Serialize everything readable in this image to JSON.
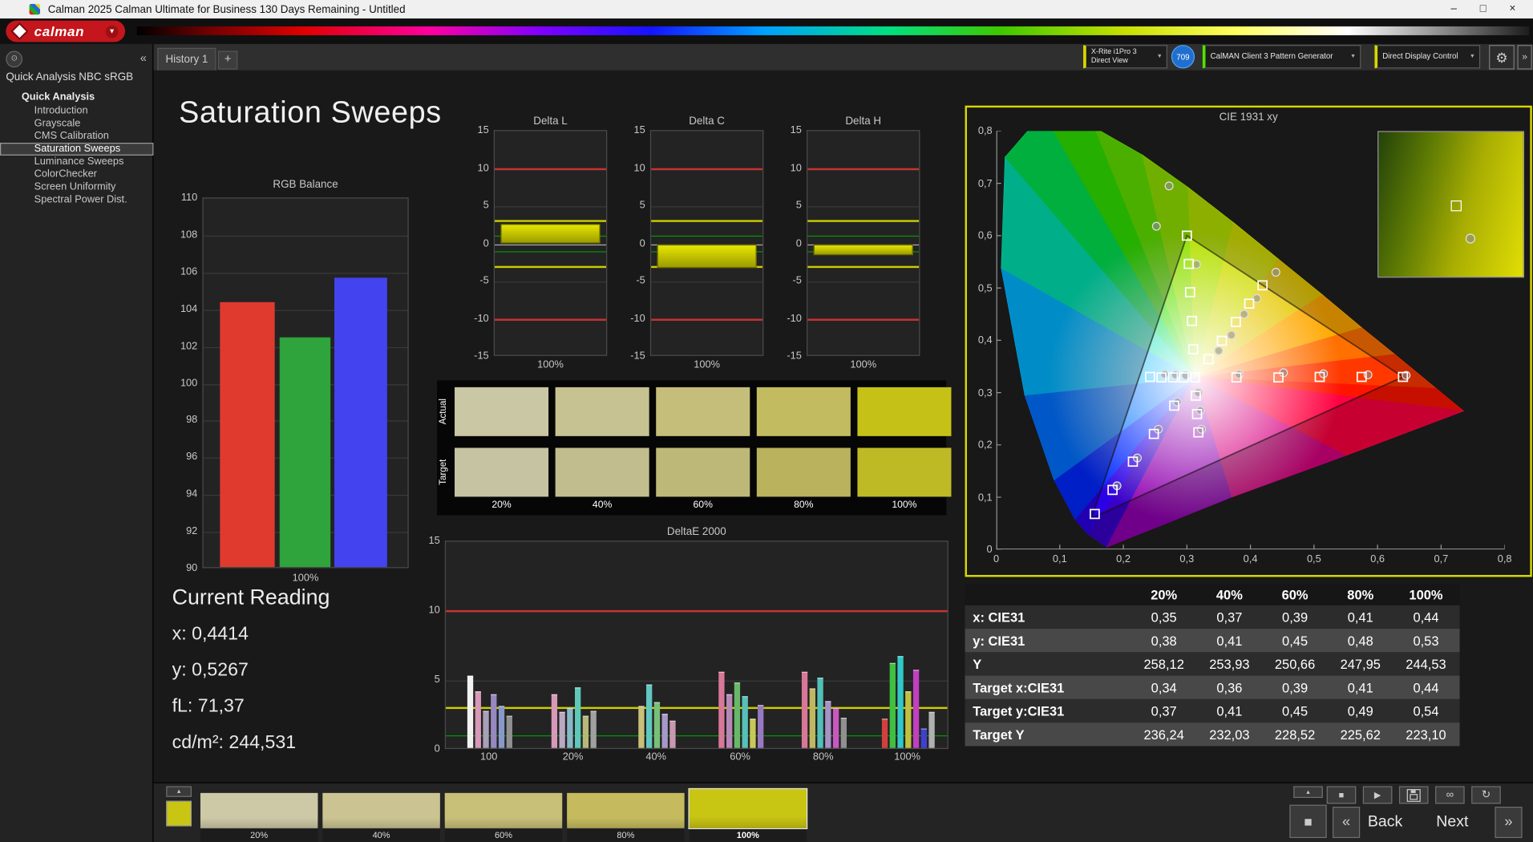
{
  "window": {
    "title": "Calman 2025 Calman Ultimate for Business 130 Days Remaining  - Untitled"
  },
  "icons": {
    "minimize": "–",
    "maximize": "□",
    "close": "×",
    "caret_down": "▼",
    "collapse": "«",
    "expand": "»",
    "add_tab": "+",
    "gear": "⚙",
    "nav_circle": "⊙",
    "stop": "■",
    "play": "▶",
    "infinity": "∞",
    "up_small": "▴",
    "refresh": "↻",
    "back_chevron": "«",
    "next_chevron": "»",
    "square": "■"
  },
  "colors": {
    "meter_accent": "#d8d800",
    "source_accent": "#54e000",
    "display_accent": "#d8d800",
    "badge_blue": "#1f6fd0",
    "ref_red": "#c83232",
    "ref_yellow": "#cccc00",
    "ref_green": "#009900",
    "panel_border_yellow": "#d8d800"
  },
  "brand": {
    "logo_text": "calman"
  },
  "tabs": {
    "history": "History 1",
    "add": "+"
  },
  "toolbar": {
    "meter_line1": "X-Rite i1Pro 3",
    "meter_line2": "Direct View",
    "badge": "709",
    "source": "CalMAN Client 3 Pattern Generator",
    "display": "Direct Display Control"
  },
  "sidebar": {
    "header": "Quick Analysis NBC sRGB",
    "root": "Quick Analysis",
    "items": [
      "Introduction",
      "Grayscale",
      "CMS Calibration",
      "Saturation Sweeps",
      "Luminance Sweeps",
      "ColorChecker",
      "Screen Uniformity",
      "Spectral Power Dist."
    ],
    "selected_index": 3
  },
  "page": {
    "title": "Saturation Sweeps"
  },
  "current_reading": {
    "title": "Current Reading",
    "lines": [
      "x: 0,4414",
      "y: 0,5267",
      "fL: 71,37",
      "cd/m²: 244,531"
    ]
  },
  "swatch_panel": {
    "row_labels": [
      "Actual",
      "Target"
    ],
    "labels": [
      "20%",
      "40%",
      "60%",
      "80%",
      "100%"
    ],
    "actual": [
      "#c9c7a4",
      "#c7c292",
      "#c5be7a",
      "#c3bb60",
      "#c5c117"
    ],
    "target": [
      "#c6c3a2",
      "#c2bd8e",
      "#beb878",
      "#bab25c",
      "#beba26"
    ]
  },
  "table": {
    "headers": [
      "20%",
      "40%",
      "60%",
      "80%",
      "100%"
    ],
    "rows": [
      {
        "label": "x: CIE31",
        "values": [
          "0,35",
          "0,37",
          "0,39",
          "0,41",
          "0,44"
        ]
      },
      {
        "label": "y: CIE31",
        "values": [
          "0,38",
          "0,41",
          "0,45",
          "0,48",
          "0,53"
        ]
      },
      {
        "label": "Y",
        "values": [
          "258,12",
          "253,93",
          "250,66",
          "247,95",
          "244,53"
        ]
      },
      {
        "label": "Target x:CIE31",
        "values": [
          "0,34",
          "0,36",
          "0,39",
          "0,41",
          "0,44"
        ]
      },
      {
        "label": "Target y:CIE31",
        "values": [
          "0,37",
          "0,41",
          "0,45",
          "0,49",
          "0,54"
        ]
      },
      {
        "label": "Target Y",
        "values": [
          "236,24",
          "232,03",
          "228,52",
          "225,62",
          "223,10"
        ]
      }
    ]
  },
  "bottom": {
    "labels": [
      "20%",
      "40%",
      "60%",
      "80%",
      "100%"
    ],
    "colors": [
      "#cdc9a6",
      "#cbc492",
      "#c8bf78",
      "#c5bb5e",
      "#c9c513"
    ],
    "selected_index": 4,
    "back": "Back",
    "next": "Next"
  },
  "chart_data": [
    {
      "id": "rgb_balance",
      "type": "bar",
      "title": "RGB Balance",
      "categories": [
        "Red",
        "Green",
        "Blue"
      ],
      "values": [
        104.3,
        102.4,
        105.6
      ],
      "colors": [
        "#e03a2f",
        "#2fa33c",
        "#4343f0"
      ],
      "ylim": [
        90,
        110
      ],
      "ytick_step": 2,
      "xlabel": "100%"
    },
    {
      "id": "delta_l",
      "type": "bar",
      "title": "Delta L",
      "values": [
        2.6
      ],
      "ylim": [
        -15,
        15
      ],
      "xlabel": "100%",
      "ref_lines": [
        {
          "v": 10,
          "c": "#c83232",
          "w": 2
        },
        {
          "v": -10,
          "c": "#c83232",
          "w": 2
        },
        {
          "v": 3,
          "c": "#cccc00",
          "w": 2
        },
        {
          "v": -3,
          "c": "#cccc00",
          "w": 2
        },
        {
          "v": 1,
          "c": "#009900",
          "w": 1
        },
        {
          "v": -1,
          "c": "#009900",
          "w": 1
        }
      ]
    },
    {
      "id": "delta_c",
      "type": "bar",
      "title": "Delta C",
      "values": [
        -3.2
      ],
      "ylim": [
        -15,
        15
      ],
      "xlabel": "100%",
      "ref_lines": [
        {
          "v": 10,
          "c": "#c83232",
          "w": 2
        },
        {
          "v": -10,
          "c": "#c83232",
          "w": 2
        },
        {
          "v": 3,
          "c": "#cccc00",
          "w": 2
        },
        {
          "v": -3,
          "c": "#cccc00",
          "w": 2
        },
        {
          "v": 1,
          "c": "#009900",
          "w": 1
        },
        {
          "v": -1,
          "c": "#009900",
          "w": 1
        }
      ]
    },
    {
      "id": "delta_h",
      "type": "bar",
      "title": "Delta H",
      "values": [
        -1.5
      ],
      "ylim": [
        -15,
        15
      ],
      "xlabel": "100%",
      "ref_lines": [
        {
          "v": 10,
          "c": "#c83232",
          "w": 2
        },
        {
          "v": -10,
          "c": "#c83232",
          "w": 2
        },
        {
          "v": 3,
          "c": "#cccc00",
          "w": 2
        },
        {
          "v": -3,
          "c": "#cccc00",
          "w": 2
        },
        {
          "v": 1,
          "c": "#009900",
          "w": 1
        },
        {
          "v": -1,
          "c": "#009900",
          "w": 1
        }
      ]
    },
    {
      "id": "deltae2000",
      "type": "bar",
      "title": "DeltaE 2000",
      "ylim": [
        0,
        15
      ],
      "categories": [
        "100",
        "20%",
        "40%",
        "60%",
        "80%",
        "100%"
      ],
      "ref_lines": [
        {
          "v": 10,
          "c": "#c83232",
          "w": 2
        },
        {
          "v": 3,
          "c": "#cccc00",
          "w": 2
        },
        {
          "v": 1,
          "c": "#009900",
          "w": 1
        }
      ],
      "groups": [
        [
          [
            5.2,
            "#f2f2f2"
          ],
          [
            4.1,
            "#d898b8"
          ],
          [
            2.7,
            "#a8a0b8"
          ],
          [
            3.9,
            "#9888c0"
          ],
          [
            3.0,
            "#8898c8"
          ],
          [
            2.3,
            "#909090"
          ]
        ],
        [
          [
            3.9,
            "#d898b8"
          ],
          [
            2.6,
            "#b8a8c0"
          ],
          [
            2.9,
            "#88b8c8"
          ],
          [
            4.4,
            "#60c8b8"
          ],
          [
            2.3,
            "#b8b878"
          ],
          [
            2.7,
            "#a0a0a0"
          ]
        ],
        [
          [
            3.0,
            "#c8c078"
          ],
          [
            4.6,
            "#60c8c0"
          ],
          [
            3.3,
            "#78c078"
          ],
          [
            2.5,
            "#a898c8"
          ],
          [
            2.0,
            "#c898b0"
          ]
        ],
        [
          [
            5.5,
            "#d87898"
          ],
          [
            3.9,
            "#b888b8"
          ],
          [
            4.7,
            "#68b868"
          ],
          [
            3.7,
            "#58c0b8"
          ],
          [
            2.1,
            "#c8c858"
          ],
          [
            3.1,
            "#9878c0"
          ]
        ],
        [
          [
            5.5,
            "#d87898"
          ],
          [
            4.3,
            "#c0b860"
          ],
          [
            5.1,
            "#50c0b8"
          ],
          [
            3.4,
            "#a890c8"
          ],
          [
            2.9,
            "#c858c0"
          ],
          [
            2.2,
            "#909090"
          ]
        ],
        [
          [
            2.1,
            "#d04040"
          ],
          [
            6.1,
            "#40c040"
          ],
          [
            6.6,
            "#30c8c8"
          ],
          [
            4.1,
            "#c0c040"
          ],
          [
            5.6,
            "#c040c0"
          ],
          [
            1.4,
            "#4040d0"
          ],
          [
            2.6,
            "#b0b0b0"
          ]
        ]
      ]
    },
    {
      "id": "cie",
      "type": "scatter",
      "title": "CIE 1931 xy",
      "xlim": [
        0,
        0.8
      ],
      "ylim": [
        0,
        0.8
      ],
      "tick_labels": [
        "0",
        "0,1",
        "0,2",
        "0,3",
        "0,4",
        "0,5",
        "0,6",
        "0,7",
        "0,8"
      ],
      "white_point": [
        0.3127,
        0.329
      ],
      "triangle": [
        [
          0.64,
          0.33
        ],
        [
          0.3,
          0.6
        ],
        [
          0.15,
          0.06
        ]
      ],
      "locus": [
        [
          0.174,
          0.005
        ],
        [
          0.144,
          0.03
        ],
        [
          0.124,
          0.058
        ],
        [
          0.091,
          0.133
        ],
        [
          0.045,
          0.295
        ],
        [
          0.008,
          0.538
        ],
        [
          0.014,
          0.75
        ],
        [
          0.074,
          0.834
        ],
        [
          0.155,
          0.806
        ],
        [
          0.23,
          0.754
        ],
        [
          0.302,
          0.692
        ],
        [
          0.373,
          0.625
        ],
        [
          0.444,
          0.555
        ],
        [
          0.513,
          0.487
        ],
        [
          0.575,
          0.424
        ],
        [
          0.627,
          0.373
        ],
        [
          0.692,
          0.308
        ],
        [
          0.735,
          0.265
        ],
        [
          0.55,
          0.18
        ],
        [
          0.37,
          0.1
        ]
      ],
      "slice_colors": [
        "#3800c8",
        "#2b00e6",
        "#0028ff",
        "#0070ff",
        "#00b4ff",
        "#00e0b0",
        "#00e050",
        "#30e000",
        "#60e000",
        "#90e000",
        "#b4e000",
        "#d0dc00",
        "#e6c800",
        "#ffa800",
        "#ff7000",
        "#ff3800",
        "#ff1400",
        "#ff0040",
        "#d80080",
        "#9000b0"
      ],
      "squares": [
        [
          0.3127,
          0.329
        ],
        [
          0.378,
          0.329
        ],
        [
          0.444,
          0.329
        ],
        [
          0.509,
          0.33
        ],
        [
          0.575,
          0.33
        ],
        [
          0.64,
          0.33
        ],
        [
          0.31,
          0.383
        ],
        [
          0.308,
          0.437
        ],
        [
          0.305,
          0.492
        ],
        [
          0.303,
          0.546
        ],
        [
          0.3,
          0.6
        ],
        [
          0.28,
          0.275
        ],
        [
          0.248,
          0.221
        ],
        [
          0.215,
          0.168
        ],
        [
          0.183,
          0.114
        ],
        [
          0.155,
          0.068
        ],
        [
          0.334,
          0.364
        ],
        [
          0.355,
          0.399
        ],
        [
          0.377,
          0.435
        ],
        [
          0.398,
          0.47
        ],
        [
          0.419,
          0.505
        ],
        [
          0.295,
          0.329
        ],
        [
          0.278,
          0.329
        ],
        [
          0.26,
          0.329
        ],
        [
          0.242,
          0.33
        ],
        [
          0.314,
          0.294
        ],
        [
          0.316,
          0.259
        ],
        [
          0.318,
          0.224
        ]
      ],
      "circles": [
        [
          0.35,
          0.38
        ],
        [
          0.37,
          0.41
        ],
        [
          0.39,
          0.45
        ],
        [
          0.41,
          0.48
        ],
        [
          0.44,
          0.53
        ],
        [
          0.382,
          0.335
        ],
        [
          0.452,
          0.338
        ],
        [
          0.515,
          0.336
        ],
        [
          0.585,
          0.334
        ],
        [
          0.645,
          0.333
        ],
        [
          0.272,
          0.695
        ],
        [
          0.252,
          0.618
        ],
        [
          0.315,
          0.545
        ],
        [
          0.285,
          0.282
        ],
        [
          0.255,
          0.23
        ],
        [
          0.222,
          0.175
        ],
        [
          0.19,
          0.122
        ],
        [
          0.298,
          0.333
        ],
        [
          0.282,
          0.334
        ],
        [
          0.265,
          0.335
        ],
        [
          0.318,
          0.3
        ],
        [
          0.321,
          0.266
        ],
        [
          0.323,
          0.23
        ]
      ],
      "inset": {
        "square": [
          0.5,
          0.47
        ],
        "circle": [
          0.6,
          0.7
        ]
      }
    }
  ]
}
